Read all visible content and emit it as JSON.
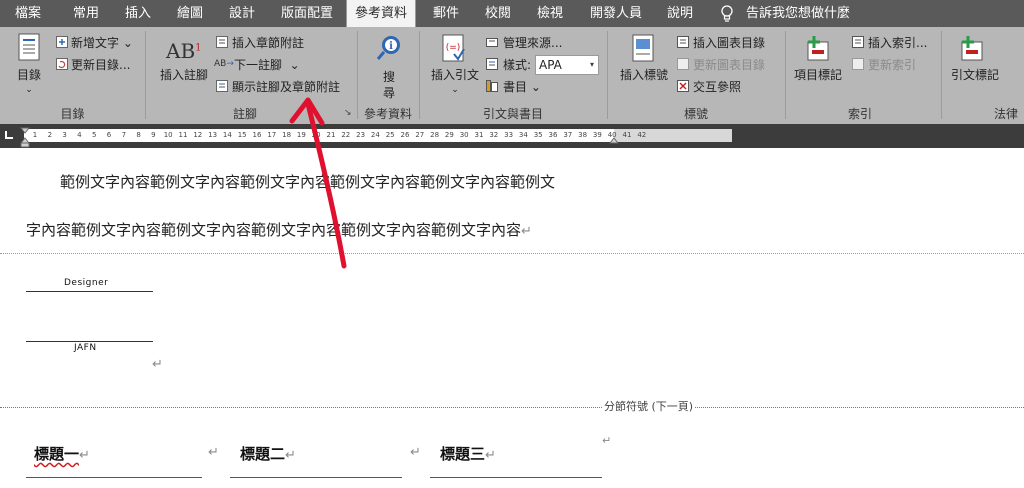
{
  "tabs": [
    "檔案",
    "常用",
    "插入",
    "繪圖",
    "設計",
    "版面配置",
    "參考資料",
    "郵件",
    "校閱",
    "檢視",
    "開發人員",
    "說明"
  ],
  "active_tab": "參考資料",
  "tell_me": "告訴我您想做什麼",
  "groups": {
    "toc": {
      "label": "目錄",
      "toc_button": "目錄",
      "add_text": "新增文字",
      "update_toc": "更新目錄..."
    },
    "footnotes": {
      "label": "註腳",
      "insert_footnote": "插入註腳",
      "insert_endnote": "插入章節附註",
      "next_footnote": "下一註腳",
      "show_notes": "顯示註腳及章節附註"
    },
    "research": {
      "label": "參考資料",
      "search": "搜\n尋"
    },
    "citations": {
      "label": "引文與書目",
      "insert_citation": "插入引文",
      "manage_sources": "管理來源...",
      "style_label": "樣式:",
      "style_value": "APA",
      "bibliography": "書目"
    },
    "captions": {
      "label": "標號",
      "insert_caption": "插入標號",
      "insert_table_of_figures": "插入圖表目錄",
      "update_table": "更新圖表目錄",
      "cross_reference": "交互參照"
    },
    "index": {
      "label": "索引",
      "mark_entry": "項目標記",
      "insert_index": "插入索引...",
      "update_index": "更新索引"
    },
    "authorities": {
      "label": "法律",
      "mark_citation": "引文標記"
    }
  },
  "ruler_numbers": [
    "1",
    "2",
    "3",
    "4",
    "5",
    "6",
    "7",
    "8",
    "9",
    "10",
    "11",
    "12",
    "13",
    "14",
    "15",
    "16",
    "17",
    "18",
    "19",
    "20",
    "21",
    "22",
    "23",
    "24",
    "25",
    "26",
    "27",
    "28",
    "29",
    "30",
    "31",
    "32",
    "33",
    "34",
    "35",
    "36",
    "37",
    "38",
    "39",
    "40",
    "41",
    "42"
  ],
  "document": {
    "line1": "範例文字內容範例文字內容範例文字內容範例文字內容範例文字內容範例文",
    "line2": "字內容範例文字內容範例文字內容範例文字內容範例文字內容範例文字內容",
    "paragraph_mark": "↵",
    "signature1": "Designer",
    "signature2": "JAFN",
    "section_break": "分節符號 (下一頁)",
    "headings": [
      "標題一",
      "標題二",
      "標題三"
    ]
  },
  "colors": {
    "tabbar": "#5a5a5a",
    "ribbon": "#b7b7b7",
    "ruler": "#3c3c3c",
    "arrow": "#e0102f"
  },
  "icons": [
    "document-icon",
    "plus-icon",
    "refresh-icon",
    "footnote-icon",
    "search-icon",
    "citation-icon",
    "caption-icon",
    "mark-entry-icon",
    "lightbulb-icon"
  ]
}
